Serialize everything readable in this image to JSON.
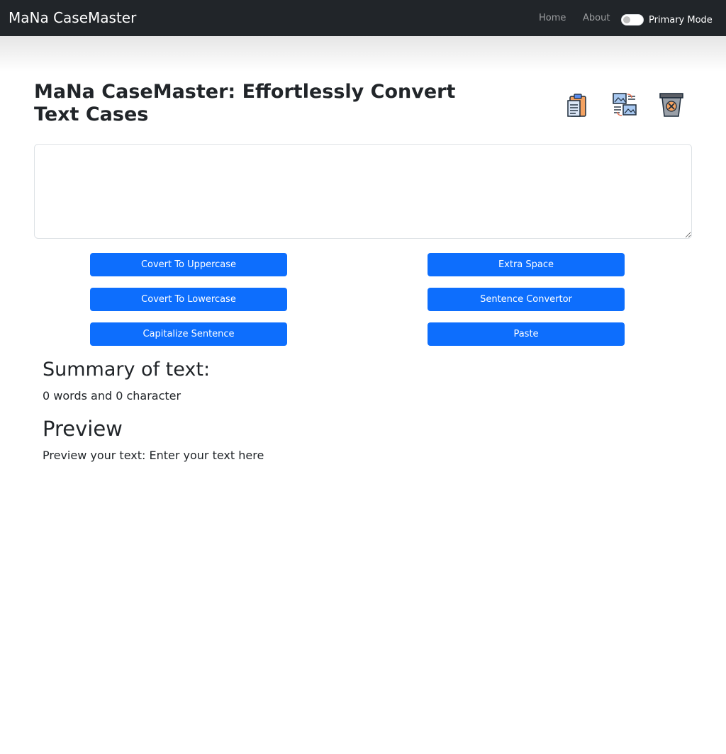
{
  "navbar": {
    "brand": "MaNa CaseMaster",
    "links": [
      "Home",
      "About"
    ],
    "mode_label": "Primary Mode"
  },
  "main": {
    "title": "MaNa CaseMaster: Effortlessly Convert Text Cases",
    "icons": [
      "copy-icon",
      "convert-icon",
      "clear-icon"
    ],
    "textarea_value": "",
    "buttons": {
      "uppercase": "Covert To Uppercase",
      "lowercase": "Covert To Lowercase",
      "capitalize": "Capitalize Sentence",
      "extra_space": "Extra Space",
      "sentence": "Sentence Convertor",
      "paste": "Paste"
    }
  },
  "summary": {
    "heading": "Summary of text:",
    "text": "0 words and 0 character"
  },
  "preview": {
    "heading": "Preview",
    "text": "Preview your text: Enter your text here"
  },
  "colors": {
    "navbar_bg": "#212529",
    "button_bg": "#0d6efd"
  }
}
